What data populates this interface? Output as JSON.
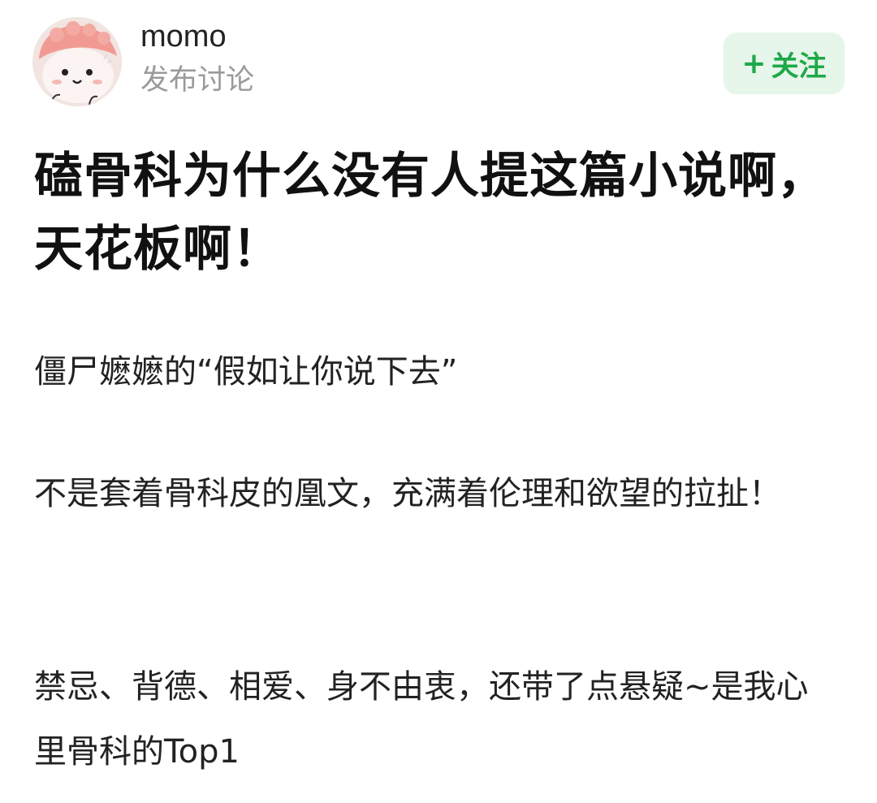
{
  "author": {
    "name": "momo",
    "action": "发布讨论",
    "avatar_icon": "cartoon-avatar-icon"
  },
  "follow_button": {
    "plus": "+",
    "label": "关注",
    "color": "#1fa84a",
    "background": "#e6f6ea"
  },
  "post": {
    "title": "磕骨科为什么没有人提这篇小说啊，天花板啊！",
    "paragraphs": [
      "僵尸嬷嬷的“假如让你说下去”",
      "不是套着骨科皮的凰文，充满着伦理和欲望的拉扯！",
      "禁忌、背德、相爱、身不由衷，还带了点悬疑~是我心里骨科的Top1"
    ]
  }
}
